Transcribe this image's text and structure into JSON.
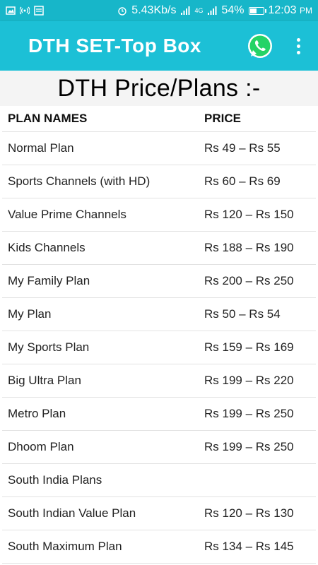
{
  "status_bar": {
    "network_speed": "5.43Kb/s",
    "network_type": "4G",
    "battery_percent": "54%",
    "battery_level": 0.54,
    "time": "12:03",
    "ampm": "PM"
  },
  "app_bar": {
    "title": "DTH SET-Top Box"
  },
  "page": {
    "heading": "DTH Price/Plans :-"
  },
  "table": {
    "headers": [
      "PLAN NAMES",
      "PRICE"
    ],
    "rows": [
      {
        "name": "Normal Plan",
        "price": "Rs 49 – Rs 55"
      },
      {
        "name": "Sports Channels (with HD)",
        "price": "Rs 60 – Rs 69"
      },
      {
        "name": "Value Prime Channels",
        "price": "Rs 120 – Rs 150"
      },
      {
        "name": "Kids Channels",
        "price": "Rs 188 – Rs 190"
      },
      {
        "name": "My Family Plan",
        "price": "Rs 200 – Rs 250"
      },
      {
        "name": "My Plan",
        "price": "Rs 50 – Rs 54"
      },
      {
        "name": "My Sports Plan",
        "price": "Rs 159 – Rs 169"
      },
      {
        "name": "Big Ultra Plan",
        "price": "Rs 199 – Rs 220"
      },
      {
        "name": "Metro Plan",
        "price": "Rs 199 – Rs 250"
      },
      {
        "name": "Dhoom Plan",
        "price": "Rs 199 – Rs 250"
      },
      {
        "name": "South India Plans",
        "price": ""
      },
      {
        "name": "South Indian Value Plan",
        "price": "Rs 120 – Rs 130"
      },
      {
        "name": "South Maximum Plan",
        "price": "Rs 134 – Rs 145"
      }
    ]
  },
  "colors": {
    "status_bar": "#17b6c9",
    "app_bar": "#1cc0d6",
    "whatsapp": "#25d366"
  }
}
